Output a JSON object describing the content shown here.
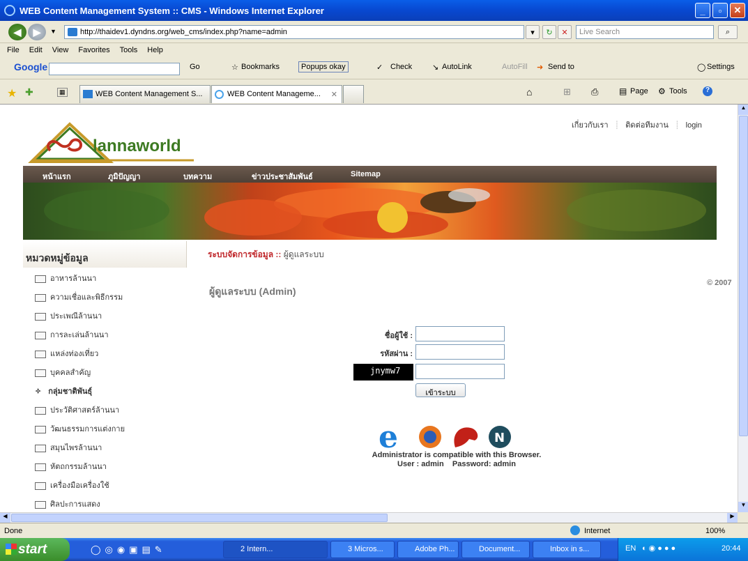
{
  "window": {
    "title": "WEB Content Management System :: CMS - Windows Internet Explorer"
  },
  "address": {
    "url": "http://thaidev1.dyndns.org/web_cms/index.php?name=admin",
    "search_placeholder": "Live Search"
  },
  "menu": [
    "File",
    "Edit",
    "View",
    "Favorites",
    "Tools",
    "Help"
  ],
  "google_toolbar": {
    "logo": "Google",
    "go": "Go",
    "bookmarks": "Bookmarks",
    "popups": "Popups okay",
    "check": "Check",
    "autolink": "AutoLink",
    "autofill": "AutoFill",
    "sendto": "Send to",
    "settings": "Settings"
  },
  "tabs": [
    {
      "label": "WEB Content Management S..."
    },
    {
      "label": "WEB Content Manageme..."
    }
  ],
  "command_bar": {
    "page": "Page",
    "tools": "Tools"
  },
  "site": {
    "logo_text": "lannaworld",
    "top_links": [
      "เกี่ยวกับเรา",
      "ติดต่อทีมงาน",
      "login"
    ],
    "nav": [
      "หน้าแรก",
      "ภูมิปัญญา",
      "บทความ",
      "ข่าวประชาสัมพันธ์",
      "Sitemap"
    ],
    "sidebar_title": "หมวดหมู่ข้อมูล",
    "categories": [
      "อาหารล้านนา",
      "ความเชื่อและพิธีกรรม",
      "ประเพณีล้านนา",
      "การละเล่นล้านนา",
      "แหล่งท่องเที่ยว",
      "บุคคลสำคัญ",
      "กลุ่มชาติพันธุ์",
      "ประวัติศาสตร์ล้านนา",
      "วัฒนธรรมการแต่งกาย",
      "สมุนไพรล้านนา",
      "หัตถกรรมล้านนา",
      "เครื่องมือเครื่องใช้",
      "ศิลปะการแสดง"
    ],
    "breadcrumb_main": "ระบบจัดการข้อมูล ::",
    "breadcrumb_sub": "ผู้ดูแลระบบ",
    "admin_title": "ผู้ดูแลระบบ (Admin)",
    "copyright": "© 2007"
  },
  "login": {
    "username_label": "ชื่อผู้ใช้ :",
    "password_label": "รหัสผ่าน :",
    "captcha": "jnymw7",
    "submit": "เข้าระบบ",
    "compat_line1": "Administrator is compatible with this Browser.",
    "compat_line2": "User : admin    Password: admin"
  },
  "status": {
    "left": "Done",
    "zone": "Internet",
    "zoom": "100%"
  },
  "taskbar": {
    "start": "start",
    "items": [
      "2 Intern...",
      "3 Micros...",
      "Adobe Ph...",
      "Document...",
      "Inbox in s..."
    ],
    "lang": "EN",
    "clock": "20:44"
  }
}
